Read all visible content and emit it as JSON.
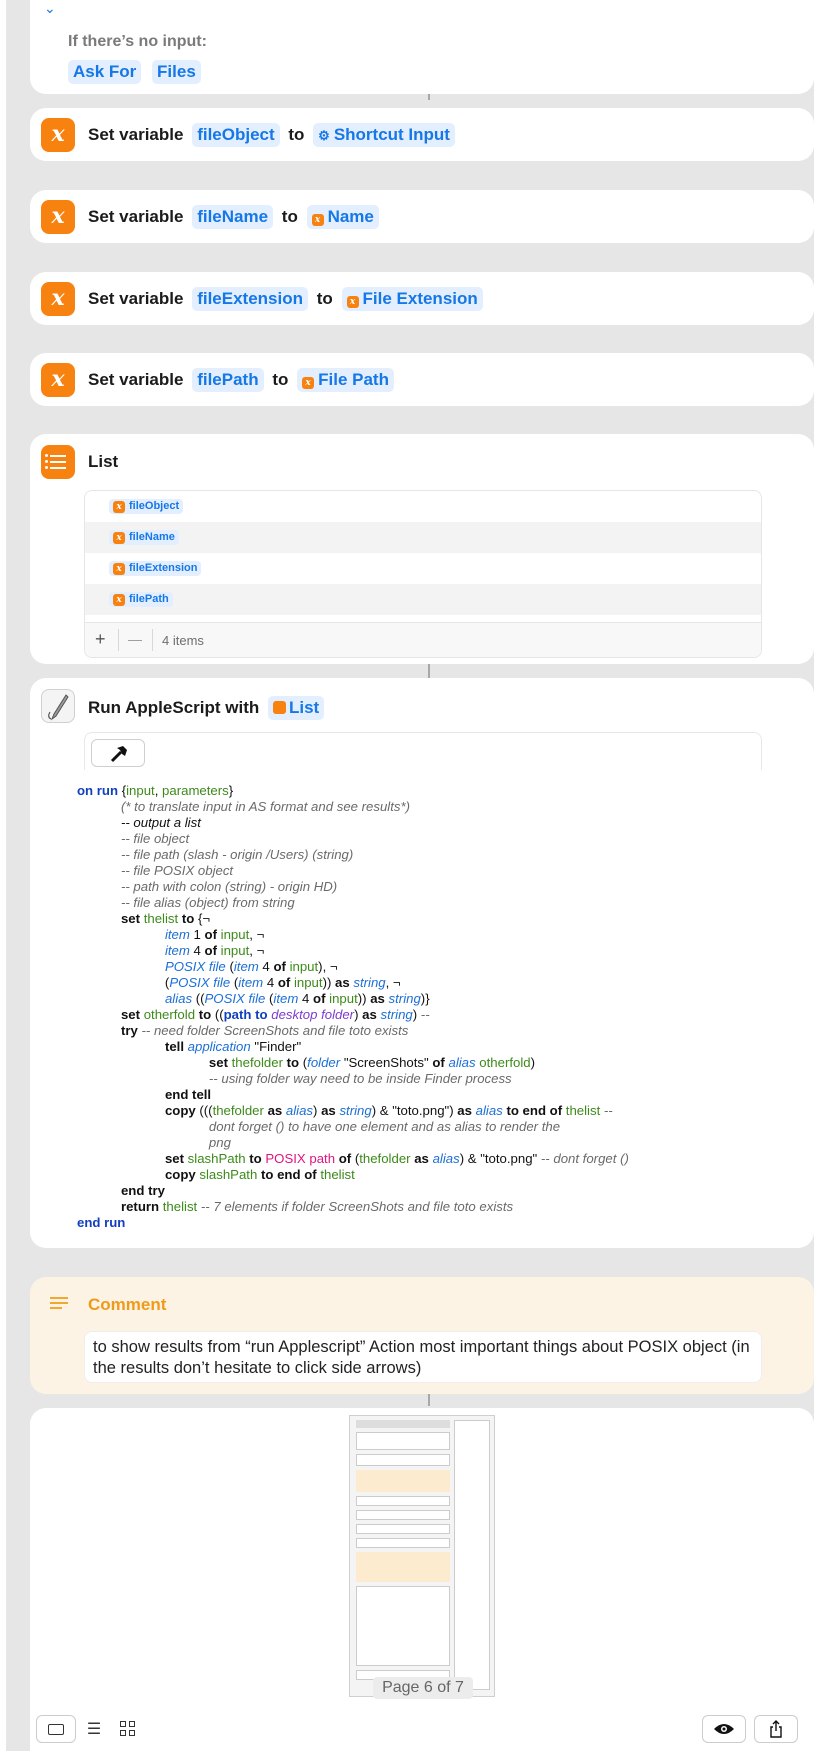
{
  "input_card": {
    "heading": "If there’s no input:",
    "tokens": [
      "Ask For",
      "Files"
    ]
  },
  "set_actions": [
    {
      "label": "Set variable",
      "variable": "fileObject",
      "to": "to",
      "value": "Shortcut Input"
    },
    {
      "label": "Set variable",
      "variable": "fileName",
      "to": "to",
      "value": "Name"
    },
    {
      "label": "Set variable",
      "variable": "fileExtension",
      "to": "to",
      "value": "File Extension"
    },
    {
      "label": "Set variable",
      "variable": "filePath",
      "to": "to",
      "value": "File Path"
    }
  ],
  "list_action": {
    "title": "List",
    "items": [
      "fileObject",
      "fileName",
      "fileExtension",
      "filePath"
    ],
    "add": "+",
    "remove": "—",
    "count": "4 items"
  },
  "script_action": {
    "title": "Run AppleScript with",
    "input_token": "List"
  },
  "comment_action": {
    "title": "Comment",
    "text": "to show results from “run Applescript” Action most important things about POSIX object (in the results don’t hesitate to click side arrows)"
  },
  "preview": {
    "page_indicator": "Page 6 of 7"
  },
  "icons": {
    "variable": "x-variable-icon",
    "list": "list-icon",
    "script": "applescript-icon",
    "hammer": "hammer-icon",
    "comment": "comment-icon"
  },
  "colors": {
    "accent": "#1677e6",
    "action_orange": "#f7820f",
    "token_bg": "#e3efff",
    "comment_bg": "#fcf3e5"
  }
}
